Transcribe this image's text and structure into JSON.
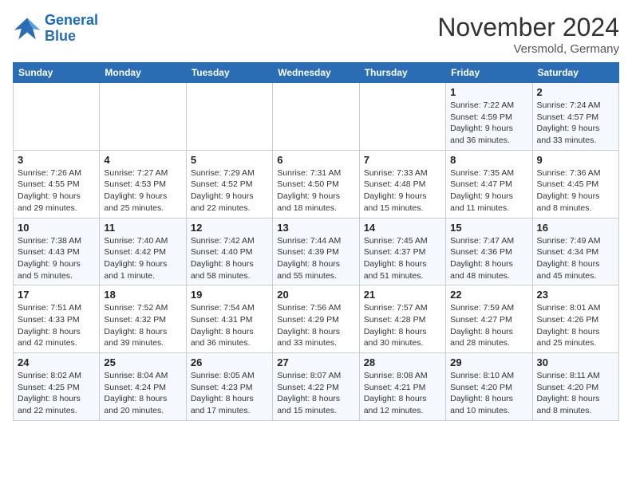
{
  "header": {
    "logo_line1": "General",
    "logo_line2": "Blue",
    "month_title": "November 2024",
    "subtitle": "Versmold, Germany"
  },
  "days_of_week": [
    "Sunday",
    "Monday",
    "Tuesday",
    "Wednesday",
    "Thursday",
    "Friday",
    "Saturday"
  ],
  "weeks": [
    [
      {
        "day": "",
        "info": ""
      },
      {
        "day": "",
        "info": ""
      },
      {
        "day": "",
        "info": ""
      },
      {
        "day": "",
        "info": ""
      },
      {
        "day": "",
        "info": ""
      },
      {
        "day": "1",
        "info": "Sunrise: 7:22 AM\nSunset: 4:59 PM\nDaylight: 9 hours\nand 36 minutes."
      },
      {
        "day": "2",
        "info": "Sunrise: 7:24 AM\nSunset: 4:57 PM\nDaylight: 9 hours\nand 33 minutes."
      }
    ],
    [
      {
        "day": "3",
        "info": "Sunrise: 7:26 AM\nSunset: 4:55 PM\nDaylight: 9 hours\nand 29 minutes."
      },
      {
        "day": "4",
        "info": "Sunrise: 7:27 AM\nSunset: 4:53 PM\nDaylight: 9 hours\nand 25 minutes."
      },
      {
        "day": "5",
        "info": "Sunrise: 7:29 AM\nSunset: 4:52 PM\nDaylight: 9 hours\nand 22 minutes."
      },
      {
        "day": "6",
        "info": "Sunrise: 7:31 AM\nSunset: 4:50 PM\nDaylight: 9 hours\nand 18 minutes."
      },
      {
        "day": "7",
        "info": "Sunrise: 7:33 AM\nSunset: 4:48 PM\nDaylight: 9 hours\nand 15 minutes."
      },
      {
        "day": "8",
        "info": "Sunrise: 7:35 AM\nSunset: 4:47 PM\nDaylight: 9 hours\nand 11 minutes."
      },
      {
        "day": "9",
        "info": "Sunrise: 7:36 AM\nSunset: 4:45 PM\nDaylight: 9 hours\nand 8 minutes."
      }
    ],
    [
      {
        "day": "10",
        "info": "Sunrise: 7:38 AM\nSunset: 4:43 PM\nDaylight: 9 hours\nand 5 minutes."
      },
      {
        "day": "11",
        "info": "Sunrise: 7:40 AM\nSunset: 4:42 PM\nDaylight: 9 hours\nand 1 minute."
      },
      {
        "day": "12",
        "info": "Sunrise: 7:42 AM\nSunset: 4:40 PM\nDaylight: 8 hours\nand 58 minutes."
      },
      {
        "day": "13",
        "info": "Sunrise: 7:44 AM\nSunset: 4:39 PM\nDaylight: 8 hours\nand 55 minutes."
      },
      {
        "day": "14",
        "info": "Sunrise: 7:45 AM\nSunset: 4:37 PM\nDaylight: 8 hours\nand 51 minutes."
      },
      {
        "day": "15",
        "info": "Sunrise: 7:47 AM\nSunset: 4:36 PM\nDaylight: 8 hours\nand 48 minutes."
      },
      {
        "day": "16",
        "info": "Sunrise: 7:49 AM\nSunset: 4:34 PM\nDaylight: 8 hours\nand 45 minutes."
      }
    ],
    [
      {
        "day": "17",
        "info": "Sunrise: 7:51 AM\nSunset: 4:33 PM\nDaylight: 8 hours\nand 42 minutes."
      },
      {
        "day": "18",
        "info": "Sunrise: 7:52 AM\nSunset: 4:32 PM\nDaylight: 8 hours\nand 39 minutes."
      },
      {
        "day": "19",
        "info": "Sunrise: 7:54 AM\nSunset: 4:31 PM\nDaylight: 8 hours\nand 36 minutes."
      },
      {
        "day": "20",
        "info": "Sunrise: 7:56 AM\nSunset: 4:29 PM\nDaylight: 8 hours\nand 33 minutes."
      },
      {
        "day": "21",
        "info": "Sunrise: 7:57 AM\nSunset: 4:28 PM\nDaylight: 8 hours\nand 30 minutes."
      },
      {
        "day": "22",
        "info": "Sunrise: 7:59 AM\nSunset: 4:27 PM\nDaylight: 8 hours\nand 28 minutes."
      },
      {
        "day": "23",
        "info": "Sunrise: 8:01 AM\nSunset: 4:26 PM\nDaylight: 8 hours\nand 25 minutes."
      }
    ],
    [
      {
        "day": "24",
        "info": "Sunrise: 8:02 AM\nSunset: 4:25 PM\nDaylight: 8 hours\nand 22 minutes."
      },
      {
        "day": "25",
        "info": "Sunrise: 8:04 AM\nSunset: 4:24 PM\nDaylight: 8 hours\nand 20 minutes."
      },
      {
        "day": "26",
        "info": "Sunrise: 8:05 AM\nSunset: 4:23 PM\nDaylight: 8 hours\nand 17 minutes."
      },
      {
        "day": "27",
        "info": "Sunrise: 8:07 AM\nSunset: 4:22 PM\nDaylight: 8 hours\nand 15 minutes."
      },
      {
        "day": "28",
        "info": "Sunrise: 8:08 AM\nSunset: 4:21 PM\nDaylight: 8 hours\nand 12 minutes."
      },
      {
        "day": "29",
        "info": "Sunrise: 8:10 AM\nSunset: 4:20 PM\nDaylight: 8 hours\nand 10 minutes."
      },
      {
        "day": "30",
        "info": "Sunrise: 8:11 AM\nSunset: 4:20 PM\nDaylight: 8 hours\nand 8 minutes."
      }
    ]
  ]
}
